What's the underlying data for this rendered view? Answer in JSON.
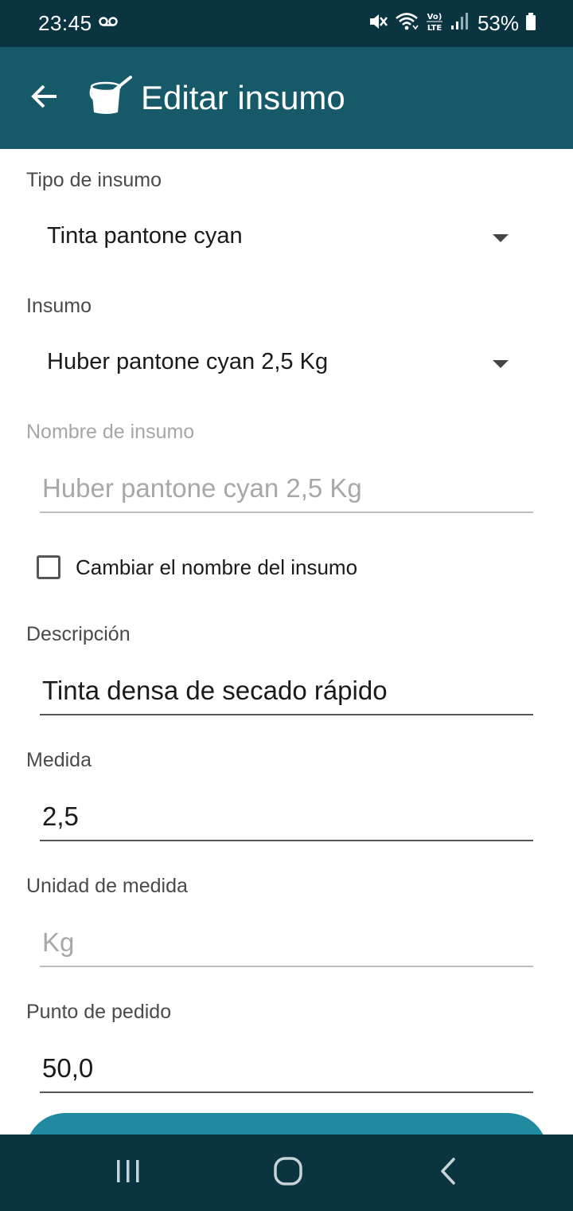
{
  "status_bar": {
    "time": "23:45",
    "battery": "53%",
    "icons": [
      "voicemail-icon",
      "mute-vibrate-icon",
      "wifi-icon",
      "volte-icon",
      "signal-icon",
      "battery-icon"
    ]
  },
  "app_bar": {
    "title": "Editar insumo",
    "icons": [
      "back-arrow-icon",
      "paint-bucket-icon"
    ]
  },
  "form": {
    "tipo_insumo": {
      "label": "Tipo de insumo",
      "value": "Tinta pantone cyan"
    },
    "insumo": {
      "label": "Insumo",
      "value": "Huber pantone cyan 2,5 Kg"
    },
    "nombre": {
      "label": "Nombre de insumo",
      "value": "Huber pantone cyan 2,5 Kg"
    },
    "cambiar_nombre": {
      "label": "Cambiar el nombre del insumo",
      "checked": false
    },
    "descripcion": {
      "label": "Descripción",
      "value": "Tinta densa de secado rápido"
    },
    "medida": {
      "label": "Medida",
      "value": "2,5"
    },
    "unidad": {
      "label": "Unidad de medida",
      "value": "Kg"
    },
    "punto_pedido": {
      "label": "Punto de pedido",
      "value": "50,0"
    }
  },
  "colors": {
    "status_bar": "#0b3441",
    "app_bar": "#165a6a",
    "button": "#1f8aa0"
  },
  "nav_bar": {
    "icons": [
      "recent-apps-icon",
      "home-icon",
      "back-icon"
    ]
  }
}
